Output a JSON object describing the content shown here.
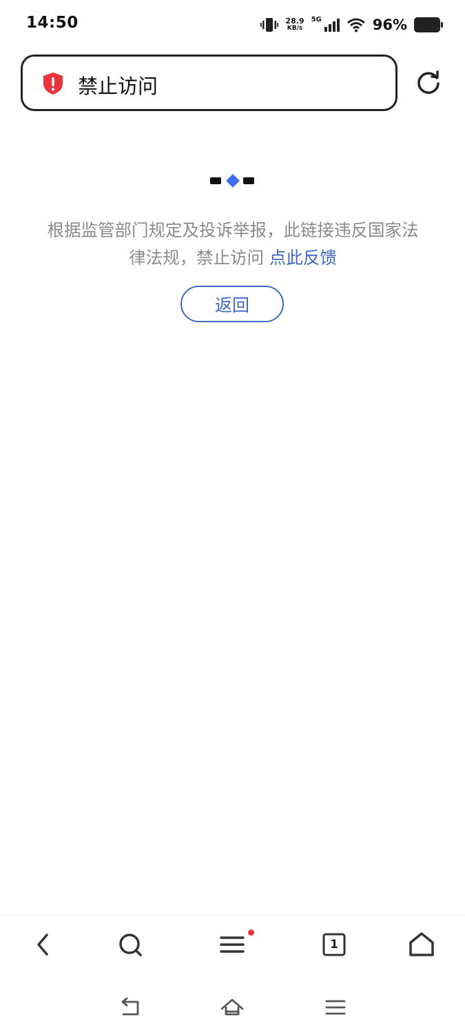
{
  "status_bar": {
    "time": "14:50",
    "speed_value": "28.9",
    "speed_unit": "KB/s",
    "network": "5G",
    "battery_percent": "96%"
  },
  "url_bar": {
    "title": "禁止访问",
    "security_icon": "shield-alert-icon",
    "refresh_icon": "refresh-icon"
  },
  "page": {
    "message": "根据监管部门规定及投诉举报，此链接违反国家法律法规，禁止访问",
    "feedback_link": "点此反馈",
    "back_button": "返回"
  },
  "toolbar": {
    "items": [
      "back-icon",
      "search-icon",
      "menu-icon",
      "tabs-icon",
      "home-icon"
    ],
    "tab_count": "1",
    "menu_has_notification": true
  },
  "system_nav": {
    "items": [
      "system-back-icon",
      "system-home-icon",
      "system-recents-icon"
    ]
  },
  "colors": {
    "accent": "#3f67c4",
    "alert_red": "#e8343b",
    "loader_blue": "#3f6ff0",
    "muted_text": "#8a8a8a"
  }
}
